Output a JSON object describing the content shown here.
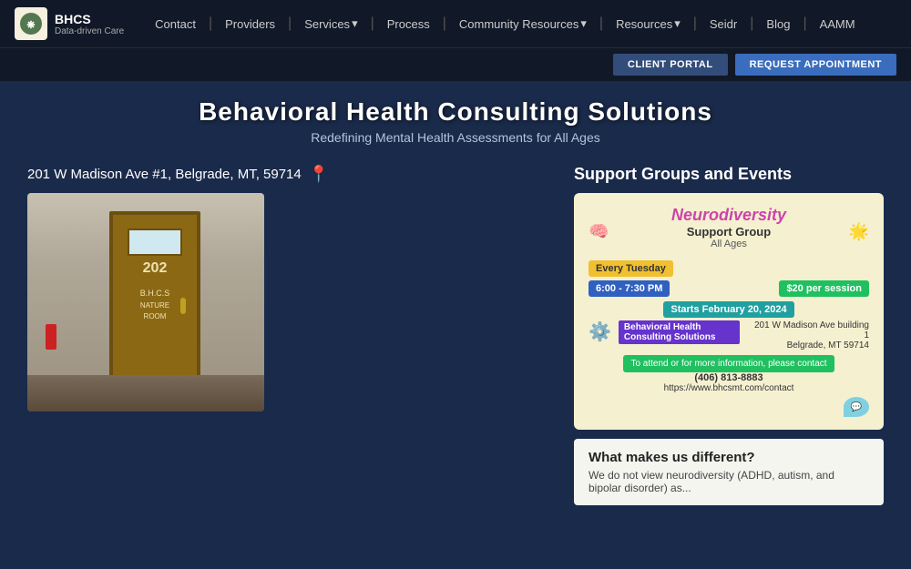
{
  "navbar": {
    "logo": {
      "title": "BHCS",
      "subtitle": "Data-driven Care"
    },
    "links": [
      {
        "label": "Contact",
        "id": "contact"
      },
      {
        "label": "Providers",
        "id": "providers"
      },
      {
        "label": "Services",
        "id": "services",
        "dropdown": true
      },
      {
        "label": "Process",
        "id": "process"
      },
      {
        "label": "Community Resources",
        "id": "community-resources",
        "dropdown": true
      },
      {
        "label": "Resources",
        "id": "resources",
        "dropdown": true
      },
      {
        "label": "Seidr",
        "id": "seidr"
      },
      {
        "label": "Blog",
        "id": "blog"
      },
      {
        "label": "AAMM",
        "id": "aamm"
      }
    ],
    "buttons": {
      "client_portal": "CLIENT PORTAL",
      "request_appointment": "REQUEST APPOINTMENT"
    }
  },
  "hero": {
    "title": "Behavioral Health Consulting Solutions",
    "subtitle": "Redefining Mental Health Assessments for All Ages"
  },
  "address": {
    "text": "201 W Madison Ave #1, Belgrade, MT, 59714"
  },
  "building_photo_alt": "BHCS office building door photo",
  "support_section": {
    "title": "Support Groups and Events",
    "flyer": {
      "neurodiversity": "Neurodiversity",
      "group_name": "Support Group",
      "all_ages": "All Ages",
      "schedule_badge": "Every Tuesday",
      "time": "6:00 - 7:30 PM",
      "price": "$20 per session",
      "starts": "Starts February 20, 2024",
      "org_badge": "Behavioral Health\nConsulting Solutions",
      "address": "201 W Madison Ave building 1\nBelgrade, MT 59714",
      "contact_badge": "To attend or for more information,\nplease contact",
      "phone": "(406) 813-8883",
      "url": "https://www.bhcsmt.com/contact"
    }
  },
  "what_makes_us_different": {
    "title": "What makes us different?",
    "text": "We do not view neurodiversity (ADHD, autism, and bipolar disorder) as..."
  }
}
